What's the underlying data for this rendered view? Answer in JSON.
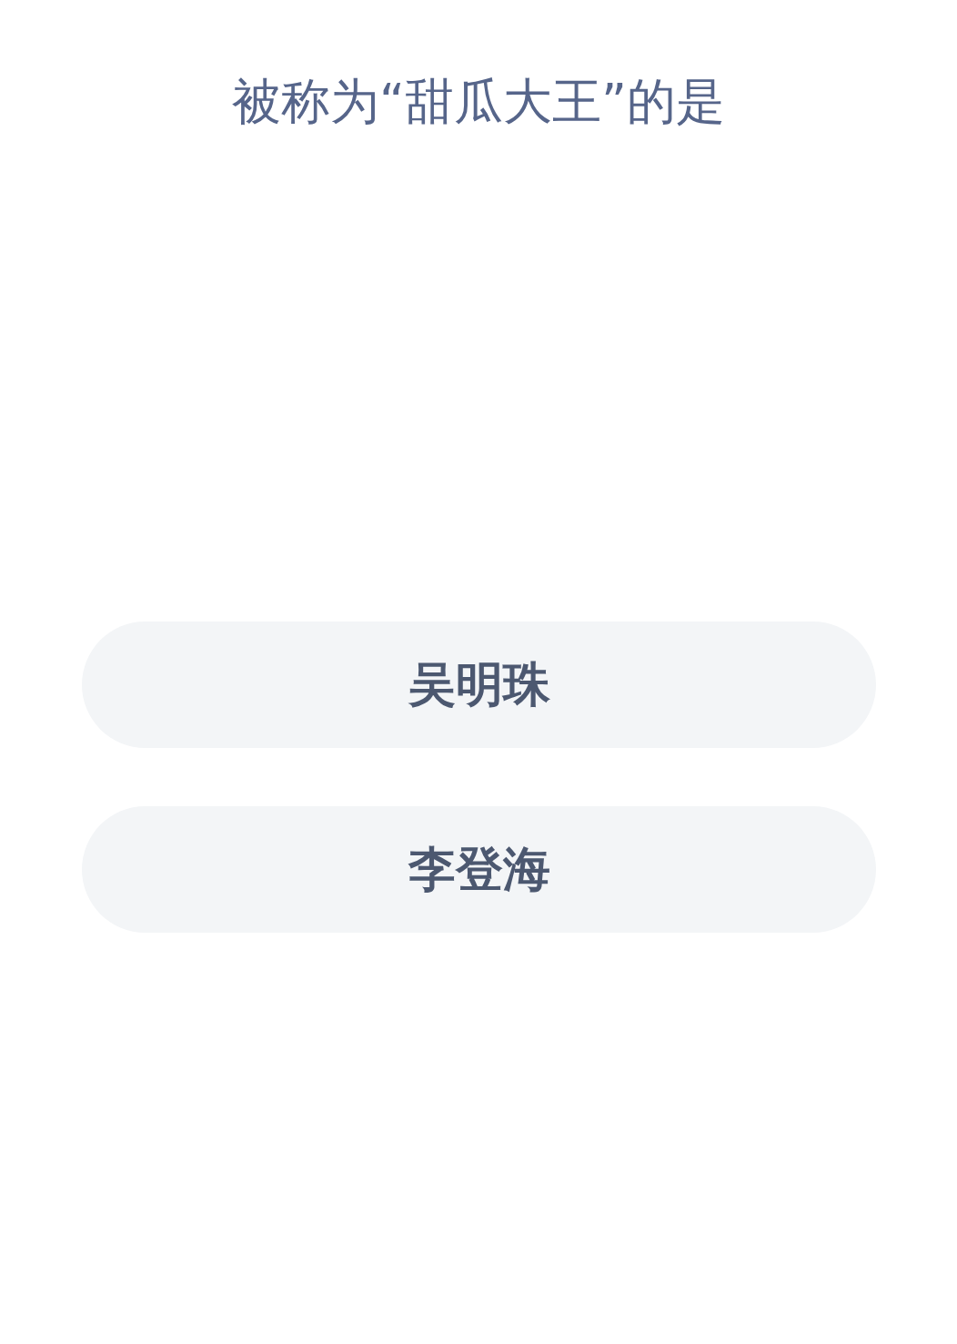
{
  "question": "被称为“甜瓜大王”的是",
  "options": [
    {
      "label": "吴明珠"
    },
    {
      "label": "李登海"
    }
  ]
}
